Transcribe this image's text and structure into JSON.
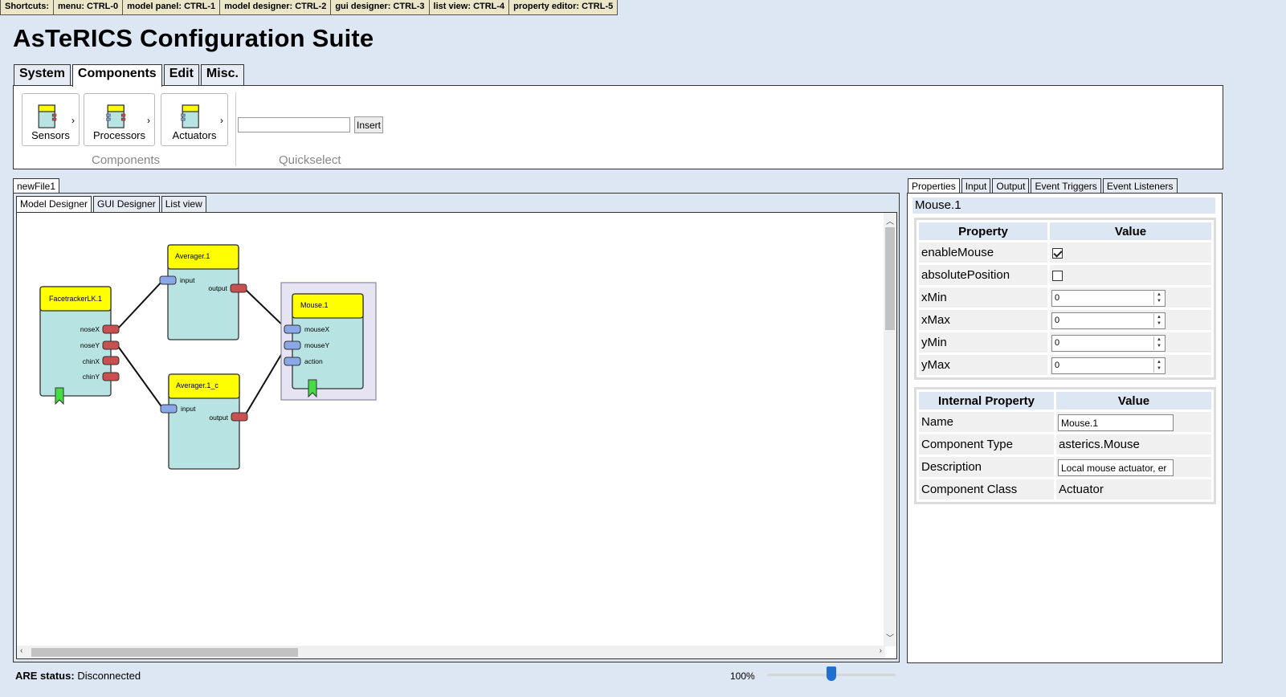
{
  "shortcuts": [
    {
      "label": "Shortcuts:"
    },
    {
      "label": "menu: CTRL-0"
    },
    {
      "label": "model panel: CTRL-1"
    },
    {
      "label": "model designer: CTRL-2"
    },
    {
      "label": "gui designer: CTRL-3"
    },
    {
      "label": "list view: CTRL-4"
    },
    {
      "label": "property editor: CTRL-5"
    }
  ],
  "app_title": "AsTeRICS Configuration Suite",
  "ribbon": {
    "tabs": [
      "System",
      "Components",
      "Edit",
      "Misc."
    ],
    "active_tab": "Components",
    "components": {
      "sensors": "Sensors",
      "processors": "Processors",
      "actuators": "Actuators",
      "group_label": "Components"
    },
    "quickselect": {
      "input_value": "",
      "insert_label": "Insert",
      "group_label": "Quickselect"
    }
  },
  "document": {
    "file_tab": "newFile1",
    "view_tabs": [
      "Model Designer",
      "GUI Designer",
      "List view"
    ],
    "active_view": "Model Designer"
  },
  "model": {
    "components": {
      "facetracker": {
        "name": "FacetrackerLK.1",
        "ports": [
          "noseX",
          "noseY",
          "chinX",
          "chinY"
        ]
      },
      "averager1": {
        "name": "Averager.1",
        "in": "input",
        "out": "output"
      },
      "averager1c": {
        "name": "Averager.1_c",
        "in": "input",
        "out": "output"
      },
      "mouse": {
        "name": "Mouse.1",
        "ports": [
          "mouseX",
          "mouseY",
          "action"
        ]
      }
    }
  },
  "properties": {
    "tabs": [
      "Properties",
      "Input",
      "Output",
      "Event Triggers",
      "Event Listeners"
    ],
    "active_tab": "Properties",
    "component_name": "Mouse.1",
    "table_headers": {
      "property": "Property",
      "value": "Value"
    },
    "rows": {
      "enableMouse": {
        "label": "enableMouse",
        "checked": true
      },
      "absolutePosition": {
        "label": "absolutePosition",
        "checked": false
      },
      "xMin": {
        "label": "xMin",
        "value": "0"
      },
      "xMax": {
        "label": "xMax",
        "value": "0"
      },
      "yMin": {
        "label": "yMin",
        "value": "0"
      },
      "yMax": {
        "label": "yMax",
        "value": "0"
      }
    },
    "internal_headers": {
      "property": "Internal Property",
      "value": "Value"
    },
    "internal": {
      "name": {
        "label": "Name",
        "value": "Mouse.1"
      },
      "type": {
        "label": "Component Type",
        "value": "asterics.Mouse"
      },
      "description": {
        "label": "Description",
        "value": "Local mouse actuator, er"
      },
      "class": {
        "label": "Component Class",
        "value": "Actuator"
      }
    }
  },
  "status": {
    "label": "ARE status:",
    "value": "Disconnected",
    "zoom": "100%",
    "zoom_fraction": 0.5
  },
  "colors": {
    "background": "#dde6f3",
    "component_body": "#b8e3e3",
    "component_title": "#ffff00",
    "input_port": "#8aa8e8",
    "output_port": "#c85050",
    "selected_highlight": "#e6e3f3",
    "event_marker": "#44dd44"
  }
}
